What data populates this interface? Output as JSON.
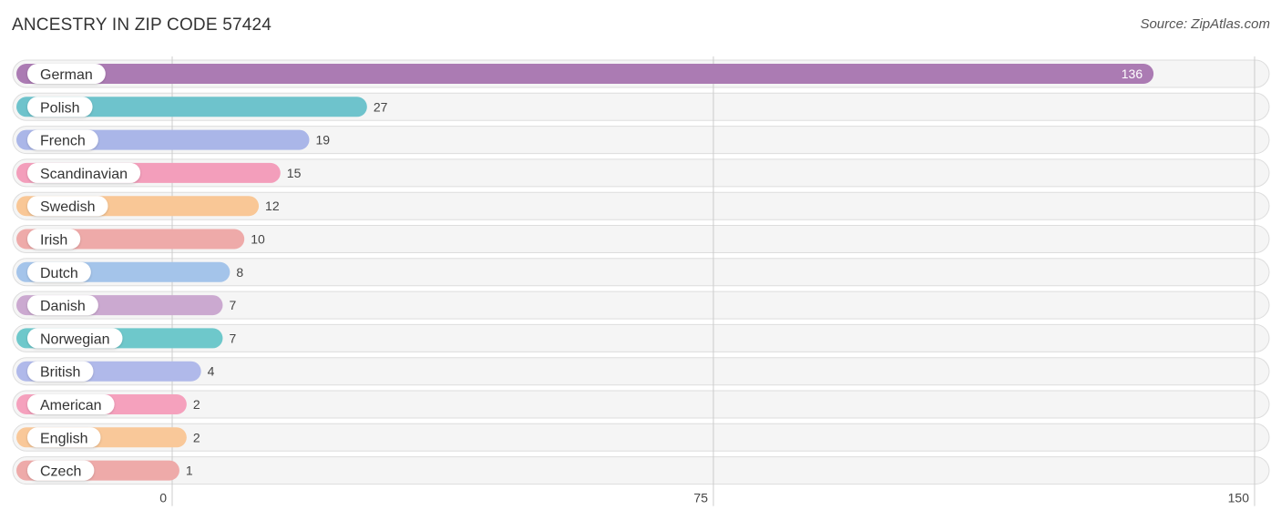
{
  "header": {
    "title": "ANCESTRY IN ZIP CODE 57424",
    "source": "Source: ZipAtlas.com"
  },
  "chart_data": {
    "type": "bar",
    "orientation": "horizontal",
    "title": "ANCESTRY IN ZIP CODE 57424",
    "xlabel": "",
    "ylabel": "",
    "xlim": [
      0,
      150
    ],
    "ticks": [
      0,
      75,
      150
    ],
    "tick_labels": [
      "0",
      "75",
      "150"
    ],
    "grid": true,
    "categories": [
      "German",
      "Polish",
      "French",
      "Scandinavian",
      "Swedish",
      "Irish",
      "Dutch",
      "Danish",
      "Norwegian",
      "British",
      "American",
      "English",
      "Czech"
    ],
    "values": [
      136,
      27,
      19,
      15,
      12,
      10,
      8,
      7,
      7,
      4,
      2,
      2,
      1
    ],
    "value_labels": [
      "136",
      "27",
      "19",
      "15",
      "12",
      "10",
      "8",
      "7",
      "7",
      "4",
      "2",
      "2",
      "1"
    ],
    "colors": [
      "#ab7bb3",
      "#6ec3cc",
      "#aab6e8",
      "#f39ebb",
      "#f9c796",
      "#eeaaa9",
      "#a4c4ea",
      "#cba9d0",
      "#6ec8cb",
      "#b0b9ea",
      "#f5a1bd",
      "#f9c899",
      "#eeaaa9"
    ]
  }
}
